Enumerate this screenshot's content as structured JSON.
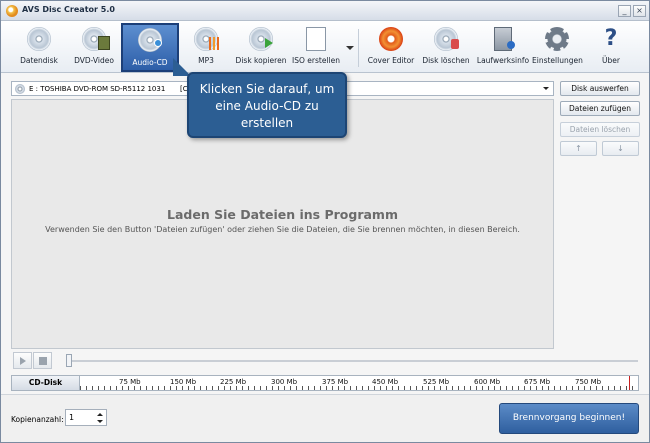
{
  "window": {
    "title": "AVS Disc Creator 5.0",
    "minimize_glyph": "_",
    "close_glyph": "×"
  },
  "toolbar": {
    "items": [
      {
        "label": "Datendisk",
        "icon": "data-disc-icon"
      },
      {
        "label": "DVD-Video",
        "icon": "dvd-video-icon"
      },
      {
        "label": "Audio-CD",
        "icon": "audio-cd-icon",
        "active": true
      },
      {
        "label": "MP3",
        "icon": "mp3-icon"
      },
      {
        "label": "Disk kopieren",
        "icon": "copy-disc-icon"
      },
      {
        "label": "ISO erstellen",
        "icon": "iso-icon"
      },
      {
        "label": "Cover Editor",
        "icon": "cover-editor-icon"
      },
      {
        "label": "Disk löschen",
        "icon": "erase-disc-icon"
      },
      {
        "label": "Laufwerksinfo",
        "icon": "drive-info-icon"
      },
      {
        "label": "Einstellungen",
        "icon": "gear-icon"
      },
      {
        "label": "Über",
        "icon": "help-icon"
      }
    ]
  },
  "drive": {
    "selected": "E : TOSHIBA  DVD-ROM SD-R5112 1031",
    "partial": "[C"
  },
  "side_buttons": {
    "eject": "Disk auswerfen",
    "add_files": "Dateien zufügen",
    "delete_files": "Dateien löschen",
    "up": "↑",
    "down": "↓"
  },
  "content": {
    "title": "Laden Sie Dateien ins Programm",
    "description": "Verwenden Sie den Button 'Dateien zufügen' oder ziehen Sie die Dateien, die Sie brennen möchten, in diesen Bereich."
  },
  "callout": {
    "text": "Klicken Sie darauf, um eine Audio-CD zu erstellen"
  },
  "capacity": {
    "disc_type": "CD-Disk",
    "ticks": [
      "75 Mb",
      "150 Mb",
      "225 Mb",
      "300 Mb",
      "375 Mb",
      "450 Mb",
      "525 Mb",
      "600 Mb",
      "675 Mb",
      "750 Mb"
    ]
  },
  "footer": {
    "copies_label": "Kopienanzahl:",
    "copies_value": "1",
    "burn_label": "Brennvorgang beginnen!"
  },
  "colors": {
    "accent": "#2c5e93",
    "active_button": "#2d5ea8",
    "capacity_marker": "#c92020"
  }
}
